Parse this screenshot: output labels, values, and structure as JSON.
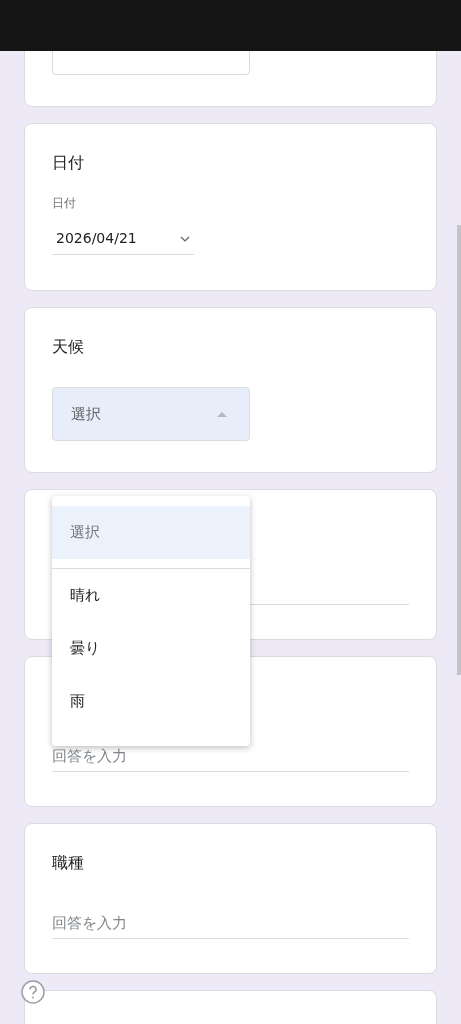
{
  "questions": [
    {
      "kind": "dropdown",
      "expanded": false
    },
    {
      "kind": "date",
      "title": "日付",
      "label": "日付",
      "value": "2026/04/21"
    },
    {
      "kind": "dropdown",
      "title": "天候",
      "placeholder": "選択",
      "expanded": true,
      "options": [
        {
          "label": "選択",
          "selected": true
        },
        {
          "label": "晴れ",
          "selected": false
        },
        {
          "label": "曇り",
          "selected": false
        },
        {
          "label": "雨",
          "selected": false
        }
      ]
    },
    {
      "kind": "text"
    },
    {
      "kind": "text",
      "placeholder": "回答を入力"
    },
    {
      "kind": "text",
      "title": "職種",
      "placeholder": "回答を入力"
    },
    {
      "kind": "partial"
    }
  ]
}
